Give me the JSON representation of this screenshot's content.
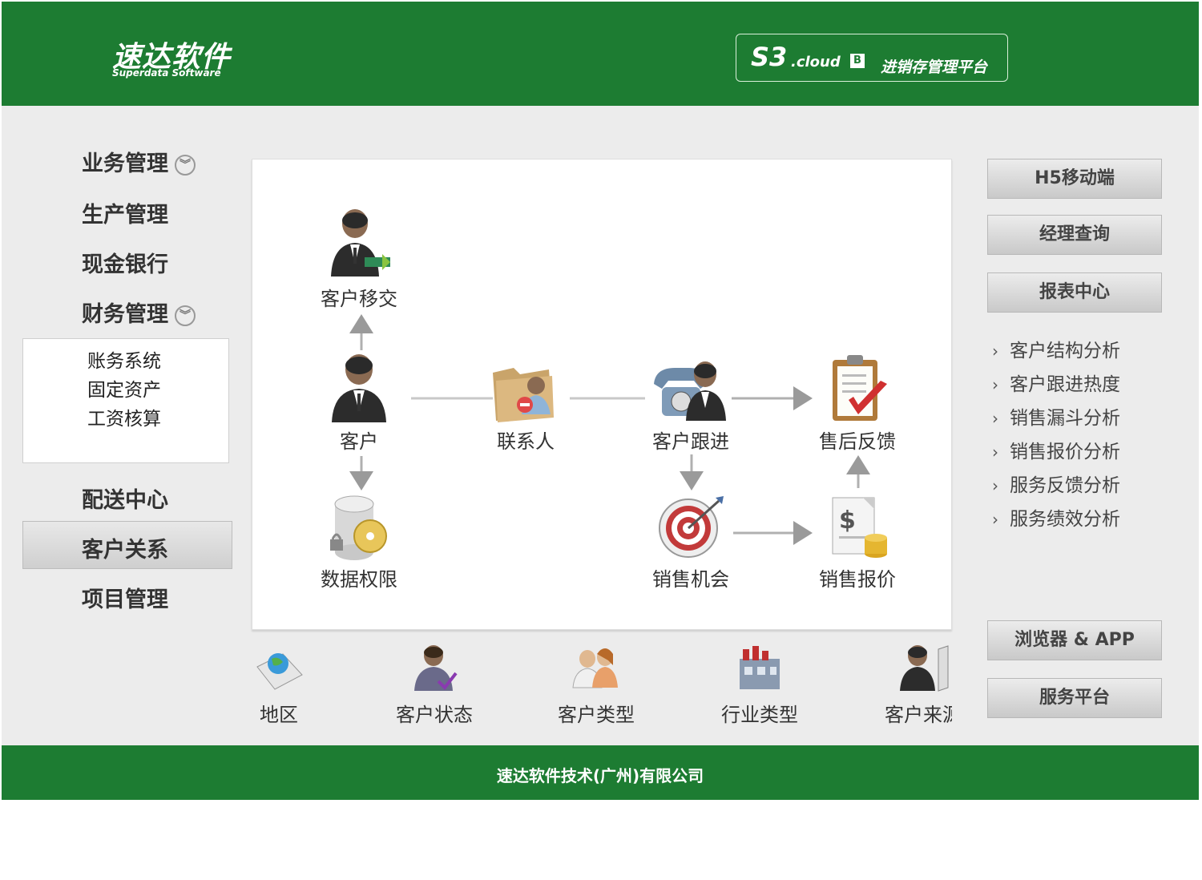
{
  "header": {
    "logo_cn": "速达软件",
    "logo_en": "Superdata Software",
    "brand_s3": "S3",
    "brand_cloud": ".cloud",
    "brand_edition": "B",
    "brand_subtitle": "进销存管理平台"
  },
  "sidebar": {
    "items": [
      {
        "label": "业务管理"
      },
      {
        "label": "生产管理"
      },
      {
        "label": "现金银行"
      },
      {
        "label": "财务管理"
      },
      {
        "label": "配送中心"
      },
      {
        "label": "客户关系"
      },
      {
        "label": "项目管理"
      }
    ],
    "finance_sub": [
      {
        "label": "账务系统"
      },
      {
        "label": "固定资产"
      },
      {
        "label": "工资核算"
      }
    ],
    "selected": "客户关系"
  },
  "flow": {
    "nodes": [
      {
        "label": "客户移交",
        "icon": "person-handover-icon"
      },
      {
        "label": "客户",
        "icon": "person-icon"
      },
      {
        "label": "数据权限",
        "icon": "database-lock-icon"
      },
      {
        "label": "联系人",
        "icon": "contact-folder-icon"
      },
      {
        "label": "客户跟进",
        "icon": "phone-person-icon"
      },
      {
        "label": "销售机会",
        "icon": "target-icon"
      },
      {
        "label": "售后反馈",
        "icon": "clipboard-check-icon"
      },
      {
        "label": "销售报价",
        "icon": "price-quote-icon"
      }
    ]
  },
  "bottom": {
    "items": [
      {
        "label": "地区",
        "icon": "globe-map-icon"
      },
      {
        "label": "客户状态",
        "icon": "person-check-icon"
      },
      {
        "label": "客户类型",
        "icon": "people-icon"
      },
      {
        "label": "行业类型",
        "icon": "factory-icon"
      },
      {
        "label": "客户来源",
        "icon": "person-door-icon"
      }
    ]
  },
  "right": {
    "top_buttons": [
      {
        "label": "H5移动端"
      },
      {
        "label": "经理查询"
      },
      {
        "label": "报表中心"
      }
    ],
    "reports": [
      {
        "label": "客户结构分析"
      },
      {
        "label": "客户跟进热度"
      },
      {
        "label": "销售漏斗分析"
      },
      {
        "label": "销售报价分析"
      },
      {
        "label": "服务反馈分析"
      },
      {
        "label": "服务绩效分析"
      }
    ],
    "bottom_buttons": [
      {
        "label": "浏览器 & APP"
      },
      {
        "label": "服务平台"
      }
    ]
  },
  "footer": {
    "company": "速达软件技术(广州)有限公司"
  },
  "colors": {
    "brand_green": "#1d7c32",
    "panel_bg": "#ececec"
  }
}
